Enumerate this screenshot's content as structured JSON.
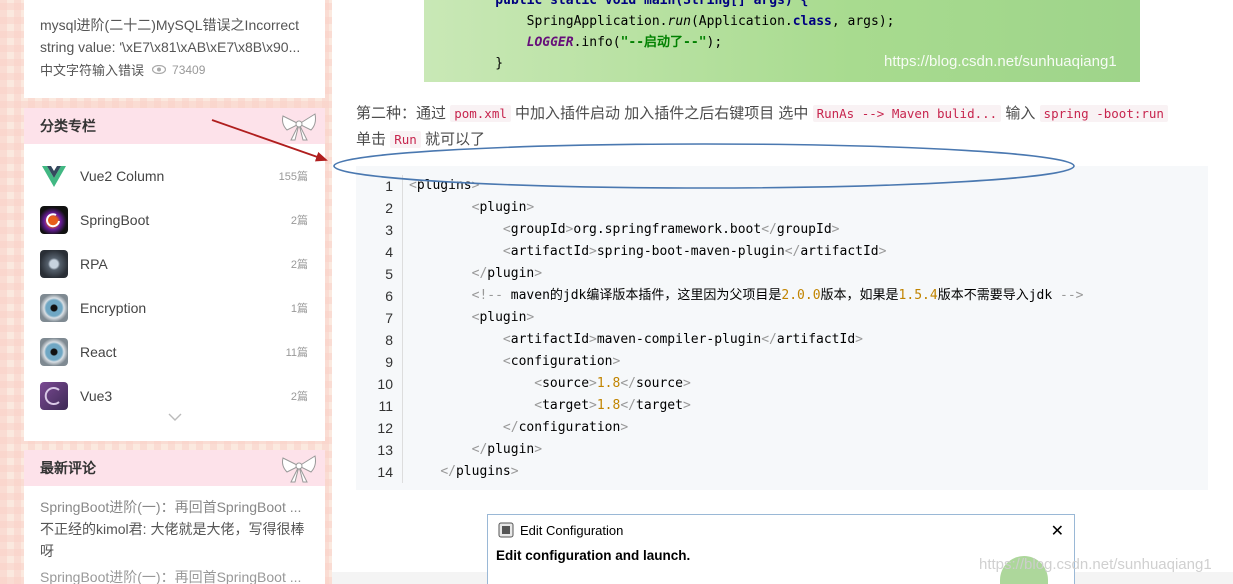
{
  "sidebar": {
    "top_article": {
      "title_line1": "mysql进阶(二十二)MySQL错误之Incorrect",
      "title_line2": "string value: '\\xE7\\x81\\xAB\\xE7\\x8B\\x90...",
      "subtitle": "中文字符输入错误",
      "views": "73409"
    },
    "categories": {
      "title": "分类专栏",
      "items": [
        {
          "label": "Vue2 Column",
          "count": "155篇"
        },
        {
          "label": "SpringBoot",
          "count": "2篇"
        },
        {
          "label": "RPA",
          "count": "2篇"
        },
        {
          "label": "Encryption",
          "count": "1篇"
        },
        {
          "label": "React",
          "count": "11篇"
        },
        {
          "label": "Vue3",
          "count": "2篇"
        }
      ]
    },
    "comments": {
      "title": "最新评论",
      "items": [
        {
          "title": "SpringBoot进阶(一)：再回首SpringBoot ...",
          "text": "不正经的kimol君: 大佬就是大佬，写得很棒呀"
        }
      ],
      "next_title": "SpringBoot进阶(一)：再回首SpringBoot ..."
    }
  },
  "main": {
    "top_code": {
      "line0": "    public static void main(String[] args) {",
      "watermark": "https://blog.csdn.net/sunhuaqiang1"
    },
    "paragraph": {
      "prefix": "第二种：通过",
      "code1": "pom.xml",
      "mid1": "中加入插件启动 加入插件之后右键项目 选中",
      "code2": "RunAs --> Maven bulid...",
      "mid2": "输入",
      "code3": "spring -boot:run",
      "line2_prefix": "单击",
      "code4": "Run",
      "line2_suffix": "就可以了"
    },
    "code_block": {
      "lines": [
        {
          "n": "1",
          "text": "<plugins>"
        },
        {
          "n": "2",
          "text": "        <plugin>"
        },
        {
          "n": "3",
          "text": "            <groupId>org.springframework.boot</groupId>"
        },
        {
          "n": "4",
          "text": "            <artifactId>spring-boot-maven-plugin</artifactId>"
        },
        {
          "n": "5",
          "text": "        </plugin>"
        },
        {
          "n": "6",
          "text": "        <!-- maven的jdk编译版本插件，这里因为父项目是2.0.0版本，如果是1.5.4版本不需要导入jdk -->"
        },
        {
          "n": "7",
          "text": "        <plugin>"
        },
        {
          "n": "8",
          "text": "            <artifactId>maven-compiler-plugin</artifactId>"
        },
        {
          "n": "9",
          "text": "            <configuration>"
        },
        {
          "n": "10",
          "text": "                <source>1.8</source>"
        },
        {
          "n": "11",
          "text": "                <target>1.8</target>"
        },
        {
          "n": "12",
          "text": "            </configuration>"
        },
        {
          "n": "13",
          "text": "        </plugin>"
        },
        {
          "n": "14",
          "text": "    </plugins>"
        }
      ]
    },
    "dialog": {
      "title": "Edit Configuration",
      "close": "✕",
      "message": "Edit configuration and launch.",
      "watermark": "https://blog.csdn.net/sunhuaqiang1"
    }
  },
  "colors": {
    "annotation_arrow": "#b01e1e",
    "annotation_ellipse": "#4a78b0",
    "header_pink": "#fde2ea"
  }
}
